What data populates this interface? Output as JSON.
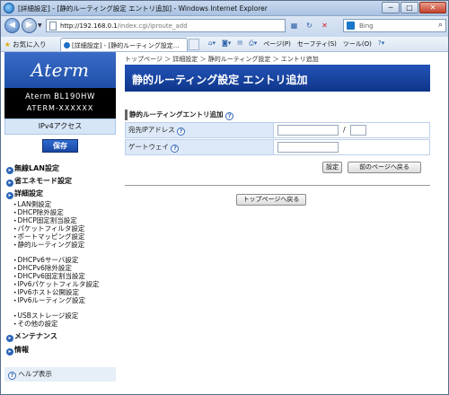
{
  "window": {
    "title": "[詳細設定] - [静的ルーティング設定 エントリ追加] - Windows Internet Explorer",
    "minimize": "─",
    "maximize": "□",
    "close": "✕"
  },
  "addressbar": {
    "url_host": "http://192.168.0.1",
    "url_path": "/index.cgi/iproute_add",
    "search_placeholder": "Bing"
  },
  "commandbar": {
    "favorites": "お気に入り",
    "tab_title": "[詳細設定] - [静的ルーティング設定...",
    "page_menu": "ページ(P)",
    "safety_menu": "セーフティ(S)",
    "tools_menu": "ツール(O)"
  },
  "sidebar": {
    "logo": "Aterm",
    "model_line1": "Aterm BL190HW",
    "model_line2": "ATERM-XXXXXX",
    "mode": "IPv4アクセス",
    "save_button": "保存",
    "categories": {
      "wireless": "無線LAN設定",
      "eco": "省エネモード設定",
      "detail": "詳細設定",
      "maintenance": "メンテナンス",
      "info": "情報"
    },
    "detail_items": [
      "LAN側設定",
      "DHCP除外設定",
      "DHCP固定割当設定",
      "パケットフィルタ設定",
      "ポートマッピング設定",
      "静的ルーティング設定",
      "DHCPv6サーバ設定",
      "DHCPv6除外設定",
      "DHCPv6固定割当設定",
      "IPv6パケットフィルタ設定",
      "IPv6ホスト公開設定",
      "IPv6ルーティング設定",
      "USBストレージ設定",
      "その他の設定"
    ],
    "help": "ヘルプ表示"
  },
  "content": {
    "breadcrumb": "トップページ ＞ 詳細設定 ＞ 静的ルーティング設定 ＞ エントリ追加",
    "title": "静的ルーティング設定 エントリ追加",
    "section_title": "静的ルーティングエントリ追加",
    "fields": {
      "dest_label": "宛先IPアドレス",
      "dest_ip_value": "",
      "dest_mask_value": "",
      "slash": "/",
      "gateway_label": "ゲートウェイ",
      "gateway_value": ""
    },
    "set_button": "設定",
    "back_button": "前のページへ戻る",
    "top_button": "トップページへ戻る"
  }
}
